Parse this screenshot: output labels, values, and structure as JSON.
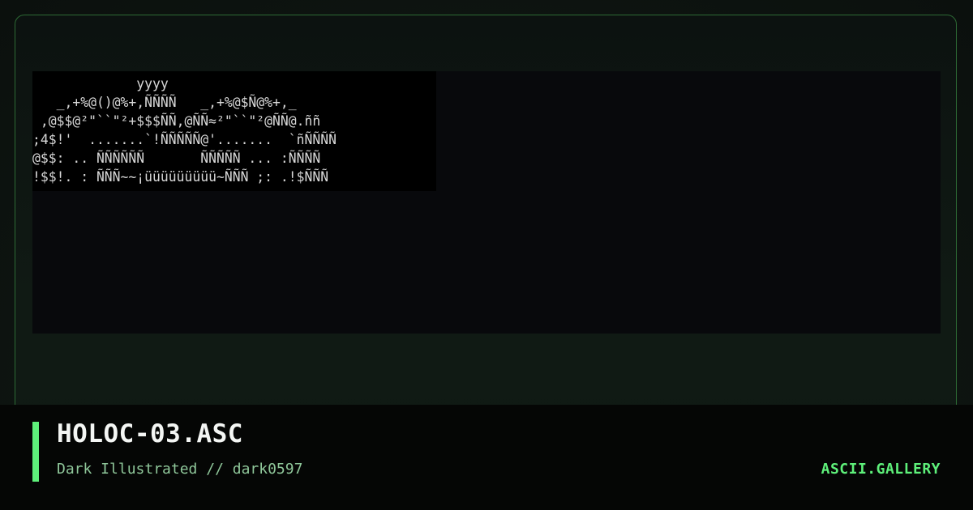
{
  "artwork": {
    "ascii": "             yyyy\n   _,+%@()@%+,ÑÑÑÑ   _,+%@$Ñ@%+,_\n ,@$$@²\"``\"²+$$$ÑÑ,@ÑÑ≈²\"``\"²@ÑÑ@.ññ\n;4$!'  .......`!ÑÑÑÑÑ@'.......  `ñÑÑÑÑ\n@$$: .. ÑÑÑÑÑÑ       ÑÑÑÑÑ ... :ÑÑÑÑ\n!$$!. : ÑÑÑ~~¡üüüüüüüüü~ÑÑÑ ;: .!$ÑÑÑ"
  },
  "footer": {
    "title": "HOLOC-03.ASC",
    "subtitle": "Dark Illustrated // dark0597",
    "brand": "ASCII.GALLERY"
  },
  "colors": {
    "accent": "#5ef07a",
    "frame_border": "#2d6b35",
    "subtitle": "#8fc79a",
    "title": "#f4f6f4",
    "ascii": "#d8d8d8"
  }
}
